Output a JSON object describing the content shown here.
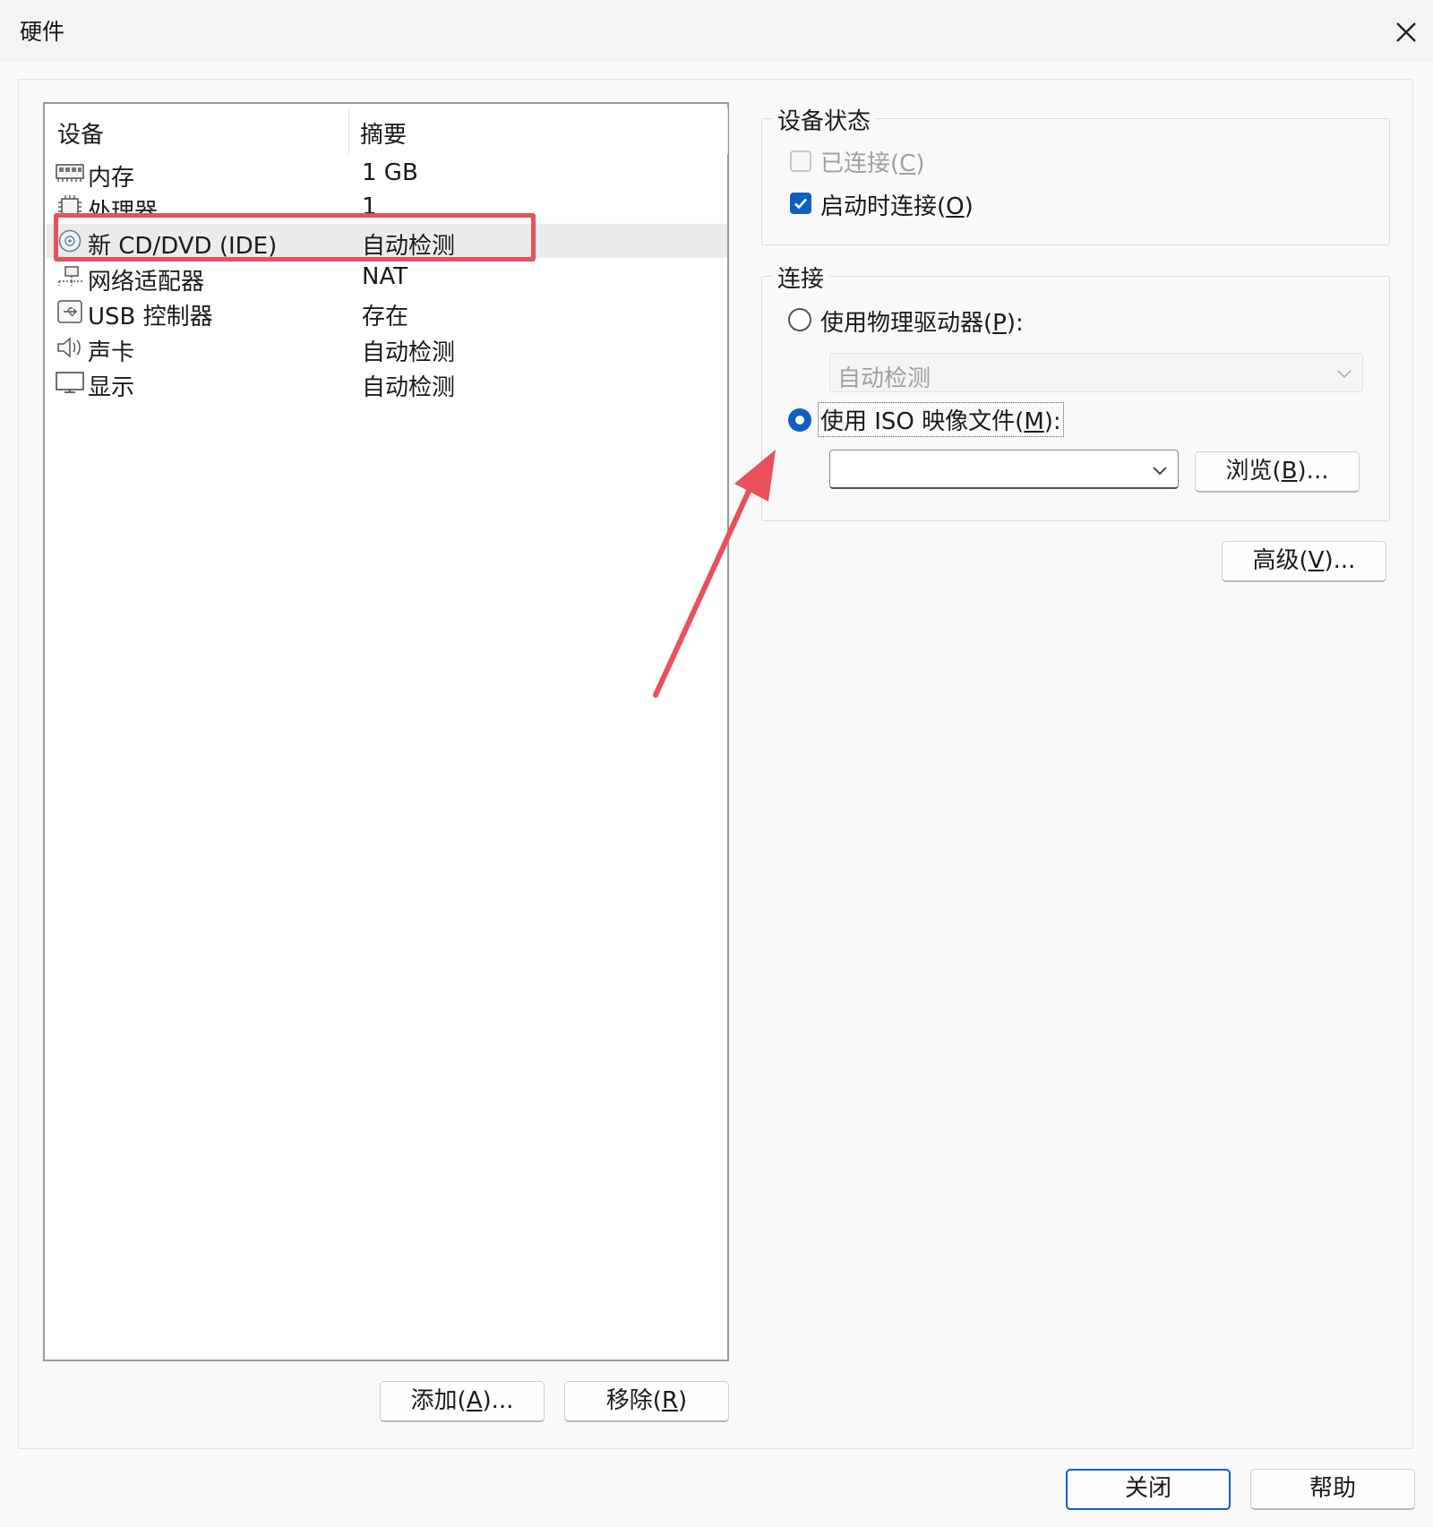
{
  "window": {
    "title": "硬件"
  },
  "device_list": {
    "headers": {
      "device": "设备",
      "summary": "摘要"
    },
    "rows": [
      {
        "icon": "memory-icon",
        "name": "内存",
        "summary": "1 GB"
      },
      {
        "icon": "processor-icon",
        "name": "处理器",
        "summary": "1"
      },
      {
        "icon": "cd-dvd-icon",
        "name": "新 CD/DVD (IDE)",
        "summary": "自动检测"
      },
      {
        "icon": "network-adapter-icon",
        "name": "网络适配器",
        "summary": "NAT"
      },
      {
        "icon": "usb-icon",
        "name": "USB 控制器",
        "summary": "存在"
      },
      {
        "icon": "sound-card-icon",
        "name": "声卡",
        "summary": "自动检测"
      },
      {
        "icon": "display-icon",
        "name": "显示",
        "summary": "自动检测"
      }
    ],
    "selected_index": 2
  },
  "buttons": {
    "add": {
      "text": "添加(",
      "key": "A",
      "tail": ")..."
    },
    "remove": {
      "text": "移除(",
      "key": "R",
      "tail": ")"
    },
    "close": "关闭",
    "help": "帮助",
    "browse": {
      "text": "浏览(",
      "key": "B",
      "tail": ")..."
    },
    "advanced": {
      "text": "高级(",
      "key": "V",
      "tail": ")..."
    }
  },
  "device_status": {
    "legend": "设备状态",
    "connected": {
      "text": "已连接(",
      "key": "C",
      "tail": ")",
      "checked": false,
      "enabled": false
    },
    "connect_at_power_on": {
      "text": "启动时连接(",
      "key": "O",
      "tail": ")",
      "checked": true
    }
  },
  "connection": {
    "legend": "连接",
    "physical_drive": {
      "text": "使用物理驱动器(",
      "key": "P",
      "tail": "):",
      "selected": false
    },
    "physical_drive_value": "自动检测",
    "iso_image": {
      "text": "使用 ISO 映像文件(",
      "key": "M",
      "tail": "):",
      "selected": true
    },
    "iso_path_value": ""
  },
  "colors": {
    "accent": "#0f5fc0",
    "annotation": "#e9505a"
  }
}
